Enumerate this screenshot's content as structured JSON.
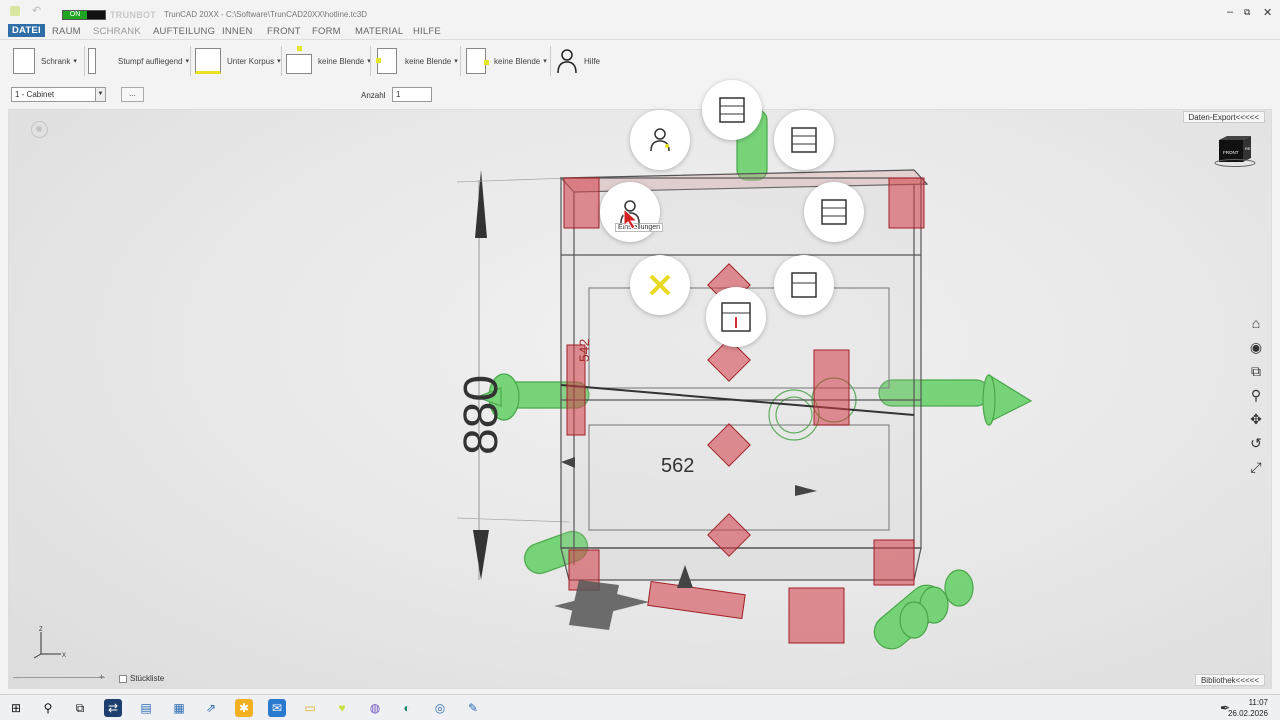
{
  "window": {
    "status_on": "ON",
    "brand": "TRUNBOT",
    "title": "TrunCAD 20XX - C:\\Software\\TrunCAD20XX\\hotline.tc3D",
    "controls": [
      "–",
      "⧉",
      "✕"
    ]
  },
  "menu": [
    "DATEI",
    "RAUM",
    "SCHRANK",
    "AUFTEILUNG",
    "INNEN",
    "FRONT",
    "FORM",
    "MATERIAL",
    "HILFE"
  ],
  "ribbon": {
    "schrank": "Schrank",
    "stumpf": "Stumpf aufliegend",
    "korpus": "Unter Korpus",
    "blende1": "keine Blende",
    "blende2": "keine Blende",
    "blende3": "keine Blende",
    "hilfe": "Hilfe"
  },
  "options": {
    "cabinet": "1 - Cabinet",
    "more": "...",
    "anzahl_label": "Anzahl",
    "anzahl_value": "1"
  },
  "viewport": {
    "export": "Daten-Export<<<<<",
    "library": "Bibliothek<<<<<",
    "stueckliste": "Stückliste",
    "dim_height": "880",
    "dim_depth": "562",
    "dim_side": "542",
    "cube_front": "FRONT",
    "cube_side": "RE",
    "axis_z": "Z",
    "axis_x": "X",
    "tooltip": "Einstellungen"
  },
  "taskbar": {
    "time": "11:07",
    "date": "26.02.2026"
  },
  "colors": {
    "accent": "#2f6ea6",
    "green": "#3fc04a",
    "red": "#d03038",
    "yellow": "#e8e020"
  }
}
